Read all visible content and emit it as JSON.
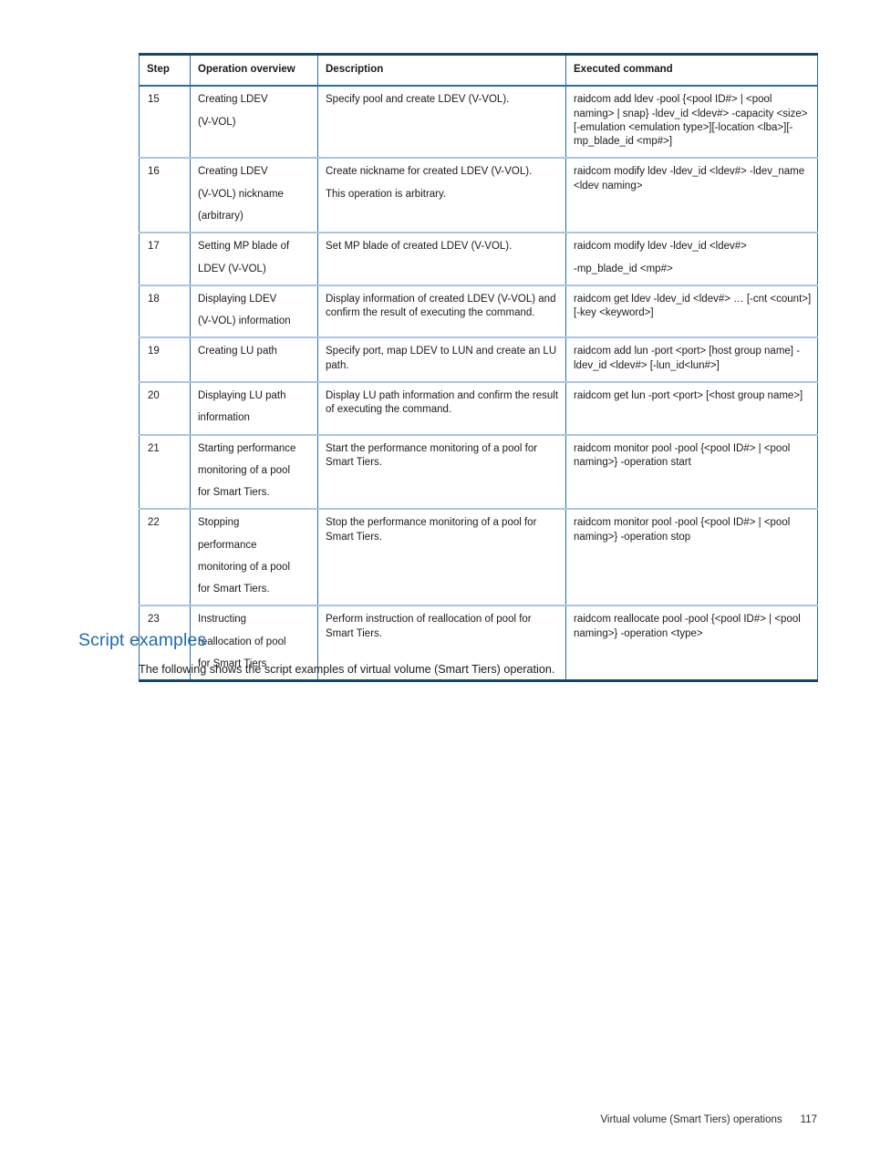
{
  "table": {
    "columns": [
      "Step",
      "Operation overview",
      "Description",
      "Executed command"
    ],
    "rows": [
      {
        "step": "15",
        "operation": [
          "Creating LDEV",
          "(V-VOL)"
        ],
        "description": [
          "Specify pool and create LDEV (V-VOL)."
        ],
        "command": [
          "raidcom add ldev -pool {<pool ID#> | <pool naming> | snap} -ldev_id <ldev#> -capacity <size> [-emulation <emulation type>][-location <lba>][-mp_blade_id <mp#>]"
        ]
      },
      {
        "step": "16",
        "operation": [
          "Creating LDEV",
          "(V-VOL) nickname",
          "(arbitrary)"
        ],
        "description": [
          "Create nickname for created LDEV (V-VOL).",
          "This operation is arbitrary."
        ],
        "command": [
          "raidcom modify ldev -ldev_id <ldev#> -ldev_name <ldev naming>"
        ]
      },
      {
        "step": "17",
        "operation": [
          "Setting MP blade of",
          "LDEV (V-VOL)"
        ],
        "description": [
          "Set MP blade of created LDEV (V-VOL)."
        ],
        "command": [
          "raidcom modify ldev -ldev_id <ldev#>",
          "-mp_blade_id <mp#>"
        ]
      },
      {
        "step": "18",
        "operation": [
          "Displaying LDEV",
          "(V-VOL) information"
        ],
        "description": [
          "Display information of created LDEV (V-VOL) and confirm the result of executing the command."
        ],
        "command": [
          "raidcom get ldev -ldev_id <ldev#> … [-cnt <count>] [-key <keyword>]"
        ]
      },
      {
        "step": "19",
        "operation": [
          "Creating LU path"
        ],
        "description": [
          "Specify port, map LDEV to LUN and create an LU path."
        ],
        "command": [
          "raidcom add lun -port <port> [host group name] -ldev_id <ldev#> [-lun_id<lun#>]"
        ]
      },
      {
        "step": "20",
        "operation": [
          "Displaying LU path",
          "information"
        ],
        "description": [
          "Display LU path information and confirm the result of executing the command."
        ],
        "command": [
          "raidcom get lun -port <port> [<host group name>]"
        ]
      },
      {
        "step": "21",
        "operation": [
          "Starting performance",
          "monitoring of a pool",
          "for Smart Tiers."
        ],
        "description": [
          "Start the performance monitoring of a pool for Smart Tiers."
        ],
        "command": [
          "raidcom monitor pool -pool {<pool ID#> | <pool naming>} -operation start"
        ]
      },
      {
        "step": "22",
        "operation": [
          "Stopping",
          "performance",
          "monitoring of a pool",
          "for Smart Tiers."
        ],
        "description": [
          "Stop the performance monitoring of a pool for Smart Tiers."
        ],
        "command": [
          "raidcom monitor pool -pool {<pool ID#> | <pool naming>} -operation stop"
        ]
      },
      {
        "step": "23",
        "operation": [
          "Instructing",
          "reallocation of pool",
          "for Smart Tiers"
        ],
        "description": [
          "Perform instruction of reallocation of pool for Smart Tiers."
        ],
        "command": [
          "raidcom reallocate pool -pool {<pool ID#> | <pool naming>} -operation <type>"
        ]
      }
    ]
  },
  "section": {
    "heading": "Script examples",
    "paragraph": "The following shows the script examples of virtual volume (Smart Tiers) operation."
  },
  "footer": {
    "title": "Virtual volume (Smart Tiers) operations",
    "page": "117"
  },
  "colors": {
    "heading_blue": "#1f6cb0",
    "table_outer_border": "#17456b",
    "table_column_border": "#2b6ca3",
    "table_row_border": "#a8c6e0",
    "text": "#1a1a1a"
  }
}
